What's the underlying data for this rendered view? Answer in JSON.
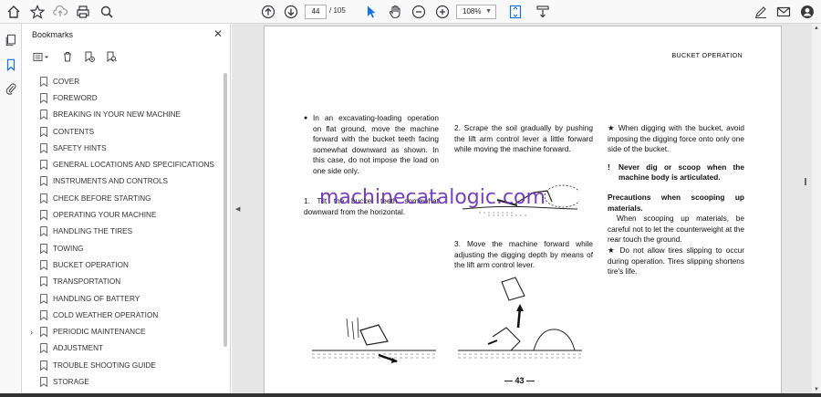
{
  "toolbar": {
    "page_current": "44",
    "page_total": "/ 105",
    "zoom": "108%",
    "icons": [
      "star-icon",
      "upload-icon",
      "print-icon",
      "search-icon",
      "prev-page-icon",
      "next-page-icon",
      "cursor-icon",
      "hand-icon",
      "zoom-out-icon",
      "zoom-in-icon",
      "fit-page-icon",
      "scroll-mode-icon",
      "sign-icon",
      "mail-icon",
      "account-icon"
    ]
  },
  "bookmarks": {
    "title": "Bookmarks",
    "close": "✕",
    "items": [
      {
        "label": "COVER"
      },
      {
        "label": "FOREWORD"
      },
      {
        "label": "BREAKING IN YOUR NEW MACHINE"
      },
      {
        "label": "CONTENTS"
      },
      {
        "label": "SAFETY HINTS"
      },
      {
        "label": "GENERAL LOCATIONS AND SPECIFICATIONS"
      },
      {
        "label": "INSTRUMENTS AND CONTROLS"
      },
      {
        "label": "CHECK BEFORE STARTING"
      },
      {
        "label": "OPERATING YOUR MACHINE"
      },
      {
        "label": "HANDLING THE TIRES"
      },
      {
        "label": "TOWING"
      },
      {
        "label": "BUCKET OPERATION"
      },
      {
        "label": "TRANSPORTATION"
      },
      {
        "label": "HANDLING OF BATTERY"
      },
      {
        "label": "COLD WEATHER OPERATION"
      },
      {
        "label": "PERIODIC MAINTENANCE",
        "expandable": true
      },
      {
        "label": "ADJUSTMENT"
      },
      {
        "label": "TROUBLE SHOOTING GUIDE"
      },
      {
        "label": "STORAGE"
      }
    ]
  },
  "doc": {
    "header": "BUCKET OPERATION",
    "col1_p1": "In an excavating-loading operation on flat ground, move the machine forward with the bucket teeth facing somewhat downward as shown. In this case, do not impose the load on one side only.",
    "col1_p2": "1. Tilt the bucket teeth somewhat downward from the horizontal.",
    "col2_p1": "2. Scrape the soil gradually by pushing the lift arm control lever a little forward while moving the machine forward.",
    "col2_p2": "3. Move the machine forward while adjusting the digging depth by means of the lift arm control lever.",
    "col3_p1": "★ When digging with the bucket, avoid imposing the digging force onto only one side of the bucket.",
    "col3_warn": "Never dig or scoop when the machine body is articulated.",
    "col3_heading": "Precautions when scooping up materials.",
    "col3_p2": "When scooping up materials, be careful not to let the counterweight at the rear touch the ground.",
    "col3_p3": "★ Do not allow tires slipping to occur during operation. Tires slipping shortens tire's life.",
    "page_number": "— 43 —",
    "watermark": "machinecatalogic.com"
  }
}
